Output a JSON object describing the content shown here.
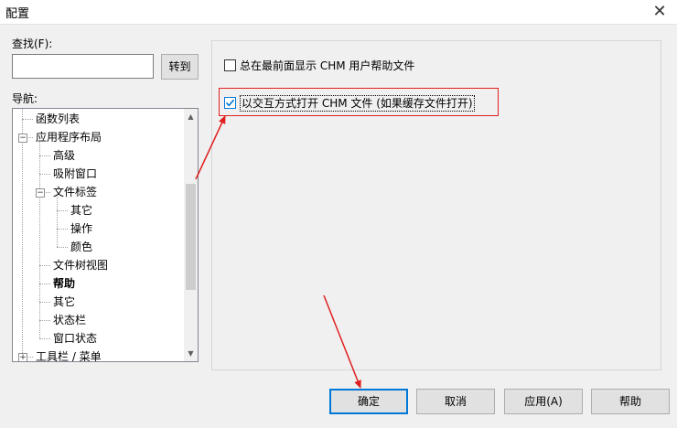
{
  "window": {
    "title": "配置"
  },
  "search": {
    "label": "查找(F):",
    "value": "",
    "goto_label": "转到"
  },
  "nav": {
    "label": "导航:",
    "items": [
      {
        "label": "函数列表",
        "level": 1,
        "bold": false,
        "expander": ""
      },
      {
        "label": "应用程序布局",
        "level": 1,
        "bold": false,
        "expander": "−"
      },
      {
        "label": "高级",
        "level": 2,
        "bold": false,
        "expander": ""
      },
      {
        "label": "吸附窗口",
        "level": 2,
        "bold": false,
        "expander": ""
      },
      {
        "label": "文件标签",
        "level": 2,
        "bold": false,
        "expander": "−"
      },
      {
        "label": "其它",
        "level": 3,
        "bold": false,
        "expander": ""
      },
      {
        "label": "操作",
        "level": 3,
        "bold": false,
        "expander": ""
      },
      {
        "label": "颜色",
        "level": 3,
        "bold": false,
        "expander": ""
      },
      {
        "label": "文件树视图",
        "level": 2,
        "bold": false,
        "expander": ""
      },
      {
        "label": "帮助",
        "level": 2,
        "bold": true,
        "expander": ""
      },
      {
        "label": "其它",
        "level": 2,
        "bold": false,
        "expander": ""
      },
      {
        "label": "状态栏",
        "level": 2,
        "bold": false,
        "expander": ""
      },
      {
        "label": "窗口状态",
        "level": 2,
        "bold": false,
        "expander": ""
      },
      {
        "label": "工具栏 / 菜单",
        "level": 1,
        "bold": false,
        "expander": "+"
      }
    ]
  },
  "options": {
    "always_on_top": {
      "label": "总在最前面显示 CHM 用户帮助文件",
      "checked": false
    },
    "interactive_open": {
      "label": "以交互方式打开 CHM 文件 (如果缓存文件打开)",
      "checked": true
    }
  },
  "buttons": {
    "ok": "确定",
    "cancel": "取消",
    "apply": "应用(A)",
    "help": "帮助"
  },
  "colors": {
    "accent": "#0078d7",
    "annotation": "#e02020"
  }
}
